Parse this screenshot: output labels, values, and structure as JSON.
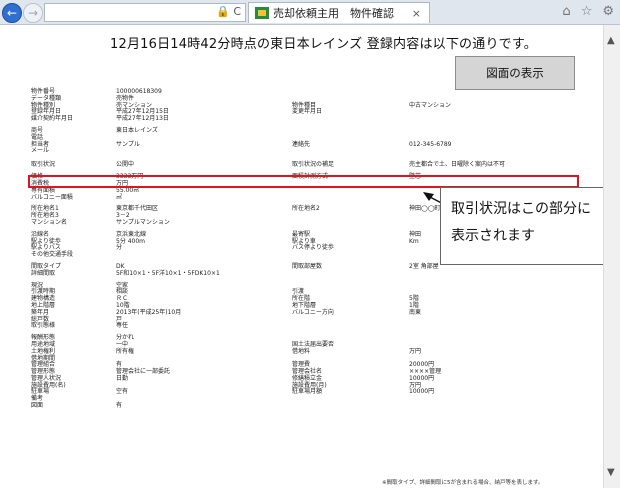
{
  "browser": {
    "tab_title": "売却依頼主用　物件確認",
    "tab_close": "×",
    "addr_icons": "🔒 C",
    "back": "←",
    "forward": "→",
    "home_icon": "⌂",
    "star_icon": "☆",
    "settings_icon": "⚙"
  },
  "page": {
    "headline": "12月16日14時42分時点の東日本レインズ 登録内容は以下の通りです。",
    "map_button": "図面の表示"
  },
  "sheet": {
    "rows": [
      {
        "c1": "物件番号",
        "c2": "100000618309",
        "c3": "",
        "c4": ""
      },
      {
        "c1": "データ種類",
        "c2": "売物件",
        "c3": "",
        "c4": ""
      },
      {
        "c1": "物件種別",
        "c2": "売マンション",
        "c3": "物件種目",
        "c4": "中古マンション"
      },
      {
        "c1": "登録年月日",
        "c2": "平成27年12月15日",
        "c3": "変更年月日",
        "c4": ""
      },
      {
        "c1": "媒介契約年月日",
        "c2": "平成27年12月13日",
        "c3": "",
        "c4": ""
      },
      {
        "gap": true
      },
      {
        "c1": "商号",
        "c2": "東日本レインズ",
        "c3": "",
        "c4": ""
      },
      {
        "c1": "電話",
        "c2": "",
        "c3": "",
        "c4": ""
      },
      {
        "c1": "担当者",
        "c2": "サンプル",
        "c3": "連絡先",
        "c4": "012-345-6789"
      },
      {
        "c1": "メール",
        "c2": "",
        "c3": "",
        "c4": ""
      },
      {
        "gap": true
      },
      {
        "c1": "取引状況",
        "c2": "公開中",
        "c3": "取引状況の補足",
        "c4": "売主都合で土、日曜除く案内は不可",
        "hl": true
      },
      {
        "gap": true
      },
      {
        "c1": "価格",
        "c2": "3333万円",
        "c3": "面積計測方式",
        "c4": "壁芯"
      },
      {
        "c1": "消費税",
        "c2": "万円",
        "c3": "",
        "c4": ""
      },
      {
        "c1": "専有面積",
        "c2": "55.00㎡",
        "c3": "",
        "c4": ""
      },
      {
        "c1": "バルコニー面積",
        "c2": "㎡",
        "c3": "",
        "c4": ""
      },
      {
        "gap": true
      },
      {
        "c1": "所在地名1",
        "c2": "東京都千代田区",
        "c3": "所在地名2",
        "c4": "神田◯◯町2丁目"
      },
      {
        "c1": "所在地名3",
        "c2": "3－2",
        "c3": "",
        "c4": ""
      },
      {
        "c1": "マンション名",
        "c2": "サンプルマンション",
        "c3": "",
        "c4": ""
      },
      {
        "gap": true
      },
      {
        "c1": "沿線名",
        "c2": "京浜東北線",
        "c3": "最寄駅",
        "c4": "神田"
      },
      {
        "c1": "駅より徒歩",
        "c2": "5分 400m",
        "c3": "駅より車",
        "c4": "Km"
      },
      {
        "c1": "駅よりバス",
        "c2": "分",
        "c3": "バス停より徒歩",
        "c4": ""
      },
      {
        "c1": "その他交通手段",
        "c2": "",
        "c3": "",
        "c4": ""
      },
      {
        "gap": true
      },
      {
        "c1": "間取タイプ",
        "c2": "DK",
        "c3": "間取部屋数",
        "c4": "2室 角部屋"
      },
      {
        "c1": "詳細間取",
        "c2": "5F和10×1・5F洋10×1・5FDK10×1",
        "c3": "",
        "c4": ""
      },
      {
        "gap": true
      },
      {
        "c1": "現況",
        "c2": "空家",
        "c3": "",
        "c4": ""
      },
      {
        "c1": "引渡時期",
        "c2": "相談",
        "c3": "引渡",
        "c4": ""
      },
      {
        "c1": "建物構造",
        "c2": "ＲＣ",
        "c3": "所在階",
        "c4": "5階"
      },
      {
        "c1": "地上階層",
        "c2": "10階",
        "c3": "地下階層",
        "c4": "1階"
      },
      {
        "c1": "築年月",
        "c2": "2013年(平成25年)10月",
        "c3": "バルコニー方向",
        "c4": "南東"
      },
      {
        "c1": "総戸数",
        "c2": "戸",
        "c3": "",
        "c4": ""
      },
      {
        "c1": "取引態様",
        "c2": "専任",
        "c3": "",
        "c4": ""
      },
      {
        "gap": true
      },
      {
        "c1": "報酬形態",
        "c2": "分かれ",
        "c3": "",
        "c4": ""
      },
      {
        "c1": "用途地域",
        "c2": "一中",
        "c3": "国土法届出要否",
        "c4": ""
      },
      {
        "c1": "土地権利",
        "c2": "所有権",
        "c3": "借地料",
        "c4": "万円"
      },
      {
        "c1": "借地期間",
        "c2": "",
        "c3": "",
        "c4": ""
      },
      {
        "c1": "管理組合",
        "c2": "有",
        "c3": "管理費",
        "c4": "20000円"
      },
      {
        "c1": "管理形態",
        "c2": "管理会社に一部委託",
        "c3": "管理会社名",
        "c4": "××××管理"
      },
      {
        "c1": "管理人状況",
        "c2": "日勤",
        "c3": "修繕積立金",
        "c4": "10000円"
      },
      {
        "c1": "施設費用(名)",
        "c2": "",
        "c3": "施設費用(月)",
        "c4": "万円"
      },
      {
        "c1": "駐車場",
        "c2": "空有",
        "c3": "駐車場月額",
        "c4": "10000円"
      },
      {
        "c1": "備考",
        "c2": "",
        "c3": "",
        "c4": ""
      },
      {
        "c1": "図面",
        "c2": "有",
        "c3": "",
        "c4": ""
      }
    ]
  },
  "callout": {
    "line1": "取引状況はこの部分に",
    "line2": "表示されます"
  },
  "footnote": "※間取タイプ、詳細間取に5が含まれる場合、納戸等を表します。"
}
